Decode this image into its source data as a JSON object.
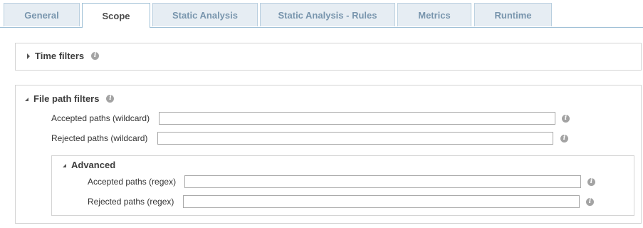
{
  "tabs": [
    {
      "label": "General",
      "active": false
    },
    {
      "label": "Scope",
      "active": true
    },
    {
      "label": "Static Analysis",
      "active": false
    },
    {
      "label": "Static Analysis - Rules",
      "active": false
    },
    {
      "label": "Metrics",
      "active": false
    },
    {
      "label": "Runtime",
      "active": false
    }
  ],
  "time_filters": {
    "title": "Time filters",
    "expanded": false,
    "info_icon": "info-icon"
  },
  "file_path_filters": {
    "title": "File path filters",
    "expanded": true,
    "info_icon": "info-icon",
    "accepted_wildcard": {
      "label": "Accepted paths (wildcard)",
      "value": "",
      "placeholder": ""
    },
    "rejected_wildcard": {
      "label": "Rejected paths (wildcard)",
      "value": "",
      "placeholder": ""
    },
    "advanced": {
      "title": "Advanced",
      "expanded": true,
      "accepted_regex": {
        "label": "Accepted paths (regex)",
        "value": "",
        "placeholder": ""
      },
      "rejected_regex": {
        "label": "Rejected paths (regex)",
        "value": "",
        "placeholder": ""
      }
    }
  },
  "info_glyph": "i",
  "colors": {
    "tab_active_text": "#4a4a4a",
    "tab_inactive_text": "#7895ad",
    "tab_inactive_bg": "#e6edf3",
    "panel_border": "#d4d4d4",
    "info_icon_bg": "#a3a3a3"
  }
}
